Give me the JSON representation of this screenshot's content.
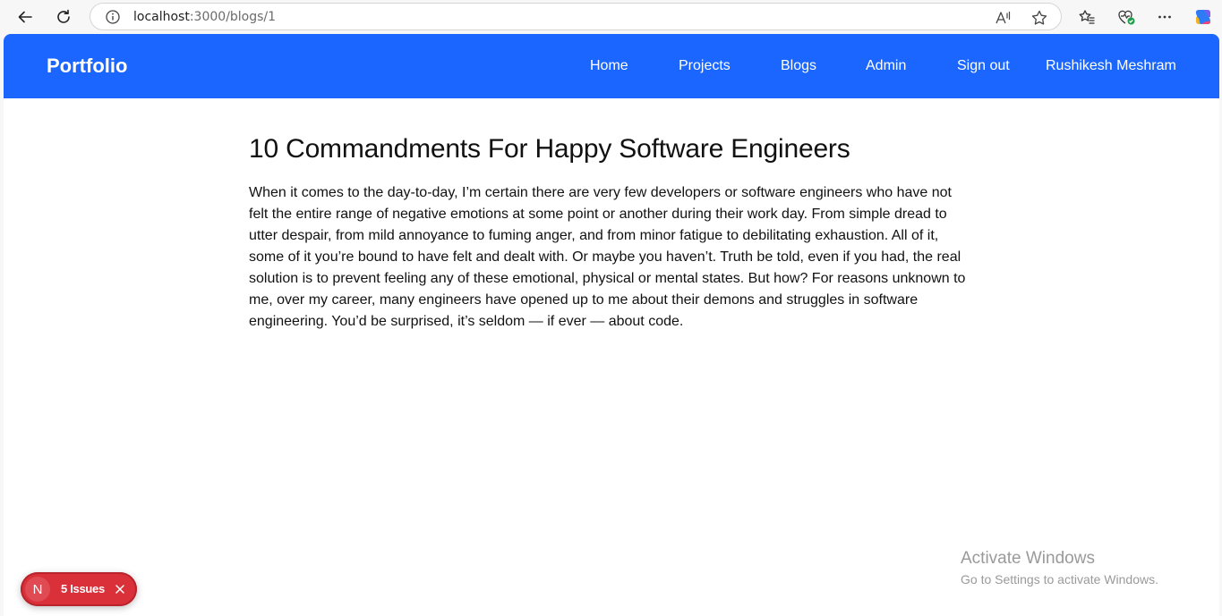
{
  "browser": {
    "url_host": "localhost",
    "url_path": ":3000/blogs/1",
    "icons": [
      "back-arrow-icon",
      "refresh-icon",
      "info-icon",
      "read-aloud-icon",
      "favorite-star-icon",
      "favorites-icon",
      "browser-essentials-icon",
      "more-icon",
      "copilot-icon"
    ]
  },
  "navbar": {
    "brand": "Portfolio",
    "links": [
      {
        "label": "Home"
      },
      {
        "label": "Projects"
      },
      {
        "label": "Blogs"
      },
      {
        "label": "Admin"
      },
      {
        "label": "Sign out"
      },
      {
        "label": "Rushikesh Meshram"
      }
    ],
    "color": "#1a66ff"
  },
  "article": {
    "title": "10 Commandments For Happy Software Engineers",
    "body": "When it comes to the day-to-day, I’m certain there are very few developers or software engineers who have not felt the entire range of negative emotions at some point or another during their work day. From simple dread to utter despair, from mild annoyance to fuming anger, and from minor fatigue to debilitating exhaustion. All of it, some of it you’re bound to have felt and dealt with. Or maybe you haven’t. Truth be told, even if you had, the real solution is to prevent feeling any of these emotional, physical or mental states. But how? For reasons unknown to me, over my career, many engineers have opened up to me about their demons and struggles in software engineering. You’d be surprised, it’s seldom — if ever — about code."
  },
  "issues_badge": {
    "letter": "N",
    "label": "5 Issues",
    "color": "#d9303a"
  },
  "watermark": {
    "title": "Activate Windows",
    "subtitle": "Go to Settings to activate Windows."
  }
}
